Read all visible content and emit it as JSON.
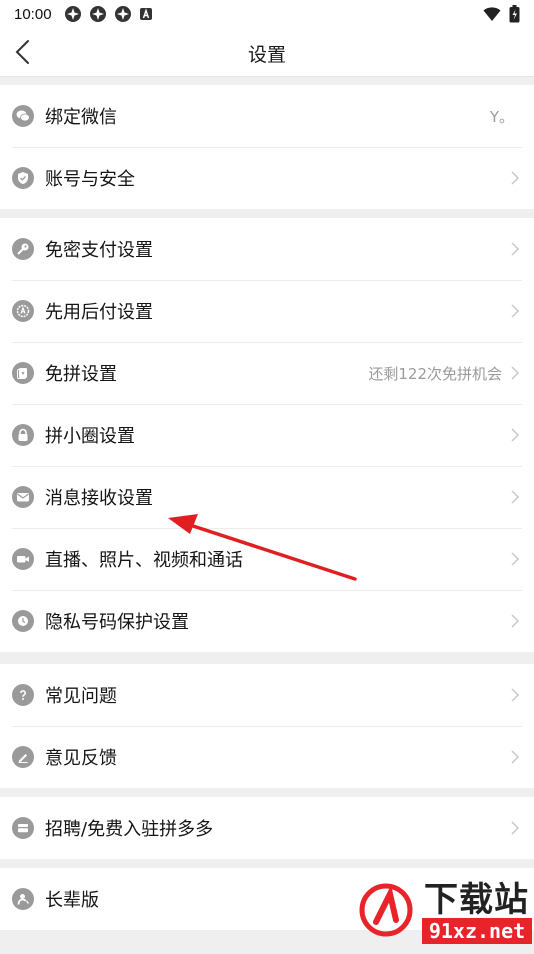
{
  "status_bar": {
    "time": "10:00",
    "notif_icons": [
      "app-notification-icon",
      "app-notification-icon",
      "app-notification-icon",
      "a-badge-icon"
    ],
    "right_icons": [
      "wifi-icon",
      "battery-icon"
    ]
  },
  "header": {
    "title": "设置"
  },
  "sections": [
    {
      "items": [
        {
          "label": "绑定微信",
          "value": "Y。",
          "icon": "wechat-icon"
        },
        {
          "label": "账号与安全",
          "value": "",
          "icon": "shield-icon"
        }
      ]
    },
    {
      "items": [
        {
          "label": "免密支付设置",
          "value": "",
          "icon": "key-icon"
        },
        {
          "label": "先用后付设置",
          "value": "",
          "icon": "badge-icon"
        },
        {
          "label": "免拼设置",
          "value": "还剩122次免拼机会",
          "icon": "card-icon"
        },
        {
          "label": "拼小圈设置",
          "value": "",
          "icon": "lock-icon"
        },
        {
          "label": "消息接收设置",
          "value": "",
          "icon": "mail-icon"
        },
        {
          "label": "直播、照片、视频和通话",
          "value": "",
          "icon": "video-icon"
        },
        {
          "label": "隐私号码保护设置",
          "value": "",
          "icon": "phone-icon"
        }
      ]
    },
    {
      "items": [
        {
          "label": "常见问题",
          "value": "",
          "icon": "question-icon"
        },
        {
          "label": "意见反馈",
          "value": "",
          "icon": "edit-icon"
        }
      ]
    },
    {
      "items": [
        {
          "label": "招聘/免费入驻拼多多",
          "value": "",
          "icon": "store-icon"
        }
      ]
    },
    {
      "items": [
        {
          "label": "长辈版",
          "value": "",
          "icon": "elder-icon"
        }
      ]
    }
  ],
  "watermark": {
    "main": "下载站",
    "sub": "91xz.net"
  },
  "colors": {
    "icon_gray": "#9a9a9a",
    "arrow_red": "#e02020",
    "watermark_red": "#e8232a"
  }
}
